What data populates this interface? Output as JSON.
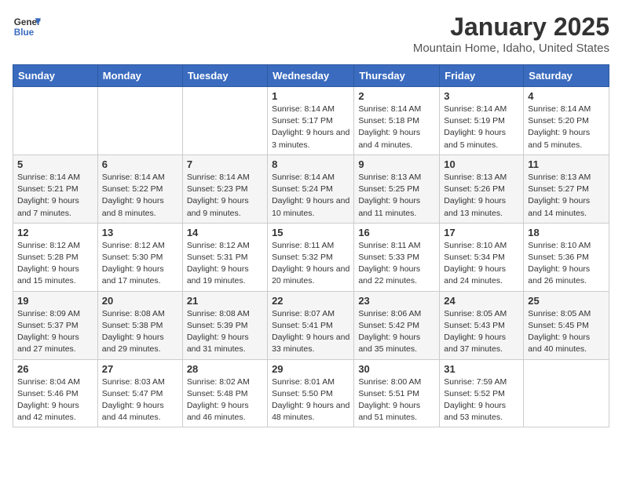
{
  "header": {
    "logo_line1": "General",
    "logo_line2": "Blue",
    "month_title": "January 2025",
    "location": "Mountain Home, Idaho, United States"
  },
  "weekdays": [
    "Sunday",
    "Monday",
    "Tuesday",
    "Wednesday",
    "Thursday",
    "Friday",
    "Saturday"
  ],
  "weeks": [
    [
      {
        "day": "",
        "info": ""
      },
      {
        "day": "",
        "info": ""
      },
      {
        "day": "",
        "info": ""
      },
      {
        "day": "1",
        "info": "Sunrise: 8:14 AM\nSunset: 5:17 PM\nDaylight: 9 hours and 3 minutes."
      },
      {
        "day": "2",
        "info": "Sunrise: 8:14 AM\nSunset: 5:18 PM\nDaylight: 9 hours and 4 minutes."
      },
      {
        "day": "3",
        "info": "Sunrise: 8:14 AM\nSunset: 5:19 PM\nDaylight: 9 hours and 5 minutes."
      },
      {
        "day": "4",
        "info": "Sunrise: 8:14 AM\nSunset: 5:20 PM\nDaylight: 9 hours and 5 minutes."
      }
    ],
    [
      {
        "day": "5",
        "info": "Sunrise: 8:14 AM\nSunset: 5:21 PM\nDaylight: 9 hours and 7 minutes."
      },
      {
        "day": "6",
        "info": "Sunrise: 8:14 AM\nSunset: 5:22 PM\nDaylight: 9 hours and 8 minutes."
      },
      {
        "day": "7",
        "info": "Sunrise: 8:14 AM\nSunset: 5:23 PM\nDaylight: 9 hours and 9 minutes."
      },
      {
        "day": "8",
        "info": "Sunrise: 8:14 AM\nSunset: 5:24 PM\nDaylight: 9 hours and 10 minutes."
      },
      {
        "day": "9",
        "info": "Sunrise: 8:13 AM\nSunset: 5:25 PM\nDaylight: 9 hours and 11 minutes."
      },
      {
        "day": "10",
        "info": "Sunrise: 8:13 AM\nSunset: 5:26 PM\nDaylight: 9 hours and 13 minutes."
      },
      {
        "day": "11",
        "info": "Sunrise: 8:13 AM\nSunset: 5:27 PM\nDaylight: 9 hours and 14 minutes."
      }
    ],
    [
      {
        "day": "12",
        "info": "Sunrise: 8:12 AM\nSunset: 5:28 PM\nDaylight: 9 hours and 15 minutes."
      },
      {
        "day": "13",
        "info": "Sunrise: 8:12 AM\nSunset: 5:30 PM\nDaylight: 9 hours and 17 minutes."
      },
      {
        "day": "14",
        "info": "Sunrise: 8:12 AM\nSunset: 5:31 PM\nDaylight: 9 hours and 19 minutes."
      },
      {
        "day": "15",
        "info": "Sunrise: 8:11 AM\nSunset: 5:32 PM\nDaylight: 9 hours and 20 minutes."
      },
      {
        "day": "16",
        "info": "Sunrise: 8:11 AM\nSunset: 5:33 PM\nDaylight: 9 hours and 22 minutes."
      },
      {
        "day": "17",
        "info": "Sunrise: 8:10 AM\nSunset: 5:34 PM\nDaylight: 9 hours and 24 minutes."
      },
      {
        "day": "18",
        "info": "Sunrise: 8:10 AM\nSunset: 5:36 PM\nDaylight: 9 hours and 26 minutes."
      }
    ],
    [
      {
        "day": "19",
        "info": "Sunrise: 8:09 AM\nSunset: 5:37 PM\nDaylight: 9 hours and 27 minutes."
      },
      {
        "day": "20",
        "info": "Sunrise: 8:08 AM\nSunset: 5:38 PM\nDaylight: 9 hours and 29 minutes."
      },
      {
        "day": "21",
        "info": "Sunrise: 8:08 AM\nSunset: 5:39 PM\nDaylight: 9 hours and 31 minutes."
      },
      {
        "day": "22",
        "info": "Sunrise: 8:07 AM\nSunset: 5:41 PM\nDaylight: 9 hours and 33 minutes."
      },
      {
        "day": "23",
        "info": "Sunrise: 8:06 AM\nSunset: 5:42 PM\nDaylight: 9 hours and 35 minutes."
      },
      {
        "day": "24",
        "info": "Sunrise: 8:05 AM\nSunset: 5:43 PM\nDaylight: 9 hours and 37 minutes."
      },
      {
        "day": "25",
        "info": "Sunrise: 8:05 AM\nSunset: 5:45 PM\nDaylight: 9 hours and 40 minutes."
      }
    ],
    [
      {
        "day": "26",
        "info": "Sunrise: 8:04 AM\nSunset: 5:46 PM\nDaylight: 9 hours and 42 minutes."
      },
      {
        "day": "27",
        "info": "Sunrise: 8:03 AM\nSunset: 5:47 PM\nDaylight: 9 hours and 44 minutes."
      },
      {
        "day": "28",
        "info": "Sunrise: 8:02 AM\nSunset: 5:48 PM\nDaylight: 9 hours and 46 minutes."
      },
      {
        "day": "29",
        "info": "Sunrise: 8:01 AM\nSunset: 5:50 PM\nDaylight: 9 hours and 48 minutes."
      },
      {
        "day": "30",
        "info": "Sunrise: 8:00 AM\nSunset: 5:51 PM\nDaylight: 9 hours and 51 minutes."
      },
      {
        "day": "31",
        "info": "Sunrise: 7:59 AM\nSunset: 5:52 PM\nDaylight: 9 hours and 53 minutes."
      },
      {
        "day": "",
        "info": ""
      }
    ]
  ]
}
